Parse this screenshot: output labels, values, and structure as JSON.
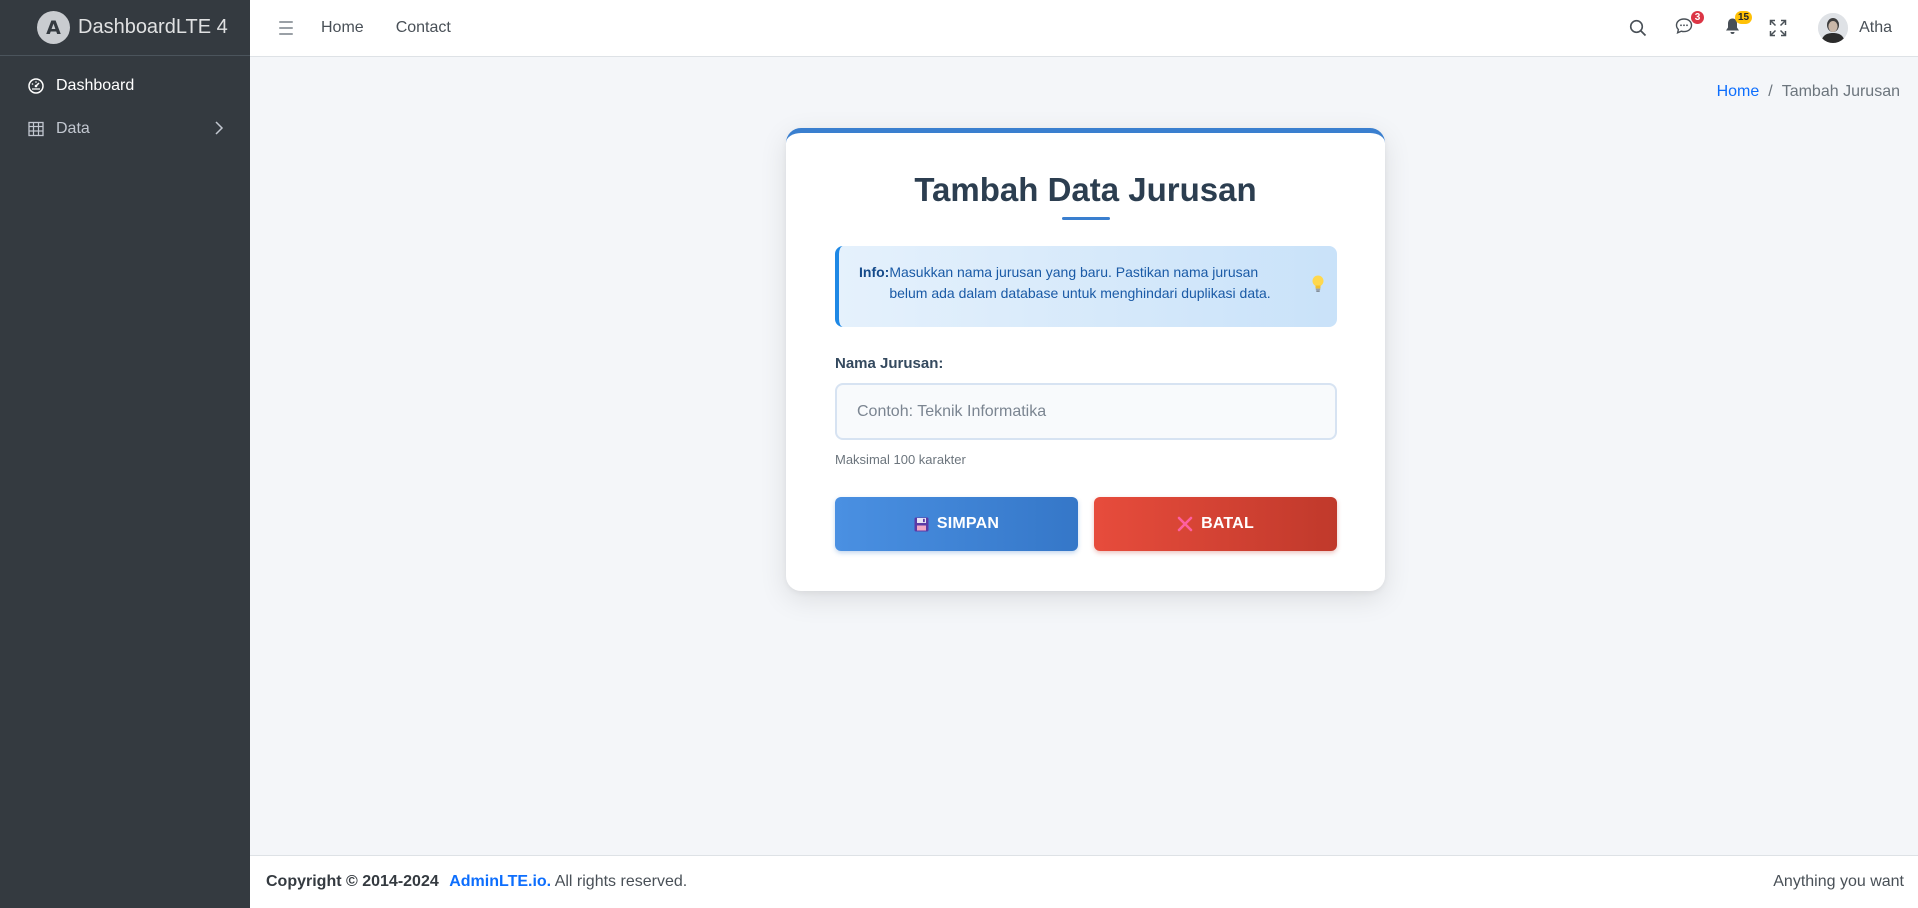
{
  "brand": {
    "logo_letter": "A",
    "name": "DashboardLTE 4"
  },
  "sidebar": {
    "items": [
      {
        "label": "Dashboard",
        "icon": "speedometer-icon"
      },
      {
        "label": "Data",
        "icon": "table-icon"
      }
    ]
  },
  "topbar": {
    "links": [
      "Home",
      "Contact"
    ],
    "messages_count": "3",
    "notifications_count": "15",
    "user_name": "Atha"
  },
  "breadcrumb": {
    "home": "Home",
    "separator": "/",
    "current": "Tambah Jurusan"
  },
  "form": {
    "title": "Tambah Data Jurusan",
    "info_label": "Info:",
    "info_text": "Masukkan nama jurusan yang baru. Pastikan nama jurusan belum ada dalam database untuk menghindari duplikasi data.",
    "field_label": "Nama Jurusan:",
    "field_placeholder": "Contoh: Teknik Informatika",
    "field_value": "",
    "help_text": "Maksimal 100 karakter",
    "save_label": "SIMPAN",
    "cancel_label": "BATAL"
  },
  "footer": {
    "copyright": "Copyright © 2014-2024",
    "link": "AdminLTE.io.",
    "rights": " All rights reserved.",
    "right_text": "Anything you want"
  },
  "colors": {
    "sidebar_bg": "#343a40",
    "primary": "#3a7fcf",
    "danger": "#e74c3c",
    "link": "#0d6efd",
    "info_bg": "#c9e2f9"
  }
}
